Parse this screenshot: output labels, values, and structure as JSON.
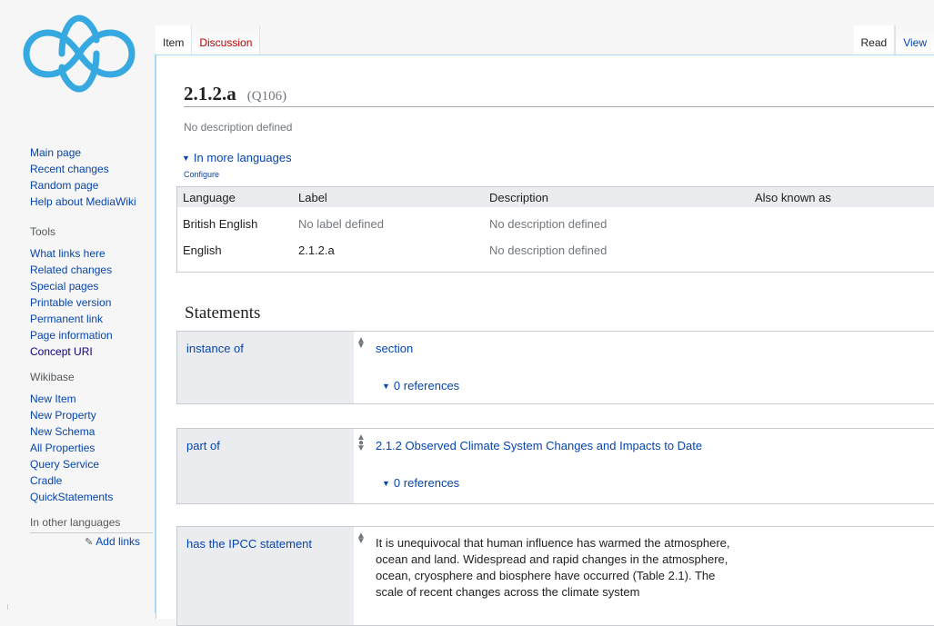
{
  "sidebar": {
    "logo_icon": "wikibase-cloud-logo-icon",
    "navigation": [
      "Main page",
      "Recent changes",
      "Random page",
      "Help about MediaWiki"
    ],
    "tools_heading": "Tools",
    "tools": [
      "What links here",
      "Related changes",
      "Special pages",
      "Printable version",
      "Permanent link",
      "Page information",
      "Concept URI"
    ],
    "wikibase_heading": "Wikibase",
    "wikibase": [
      "New Item",
      "New Property",
      "New Schema",
      "All Properties",
      "Query Service",
      "Cradle",
      "QuickStatements"
    ],
    "languages_heading": "In other languages",
    "add_links": "Add links"
  },
  "tabs": {
    "item": "Item",
    "discussion": "Discussion",
    "read": "Read",
    "view": "View"
  },
  "page": {
    "title": "2.1.2.a",
    "id": "(Q106)",
    "description": "No description defined",
    "more_languages": "In more languages",
    "configure": "Configure"
  },
  "languages_table": {
    "headers": [
      "Language",
      "Label",
      "Description",
      "Also known as"
    ],
    "rows": [
      [
        "British English",
        "No label defined",
        "No description defined",
        ""
      ],
      [
        "English",
        "2.1.2.a",
        "No description defined",
        ""
      ]
    ]
  },
  "statements": {
    "heading": "Statements",
    "items": [
      {
        "property": "instance of",
        "value": "section",
        "references": "0 references"
      },
      {
        "property": "part of",
        "value": "2.1.2 Observed Climate System Changes and Impacts to Date",
        "references": "0 references"
      },
      {
        "property": "has the IPCC statement",
        "value": "It is unequivocal that human influence has warmed the atmosphere, ocean and land. Widespread and rapid changes in the atmosphere, ocean, cryosphere and biosphere have occurred (Table 2.1). The scale of recent changes across the climate system"
      }
    ]
  },
  "colors": {
    "link": "#0645ad",
    "new_link": "#ba0000",
    "logo": "#36a9e1",
    "header_bg": "#eaecf0"
  }
}
